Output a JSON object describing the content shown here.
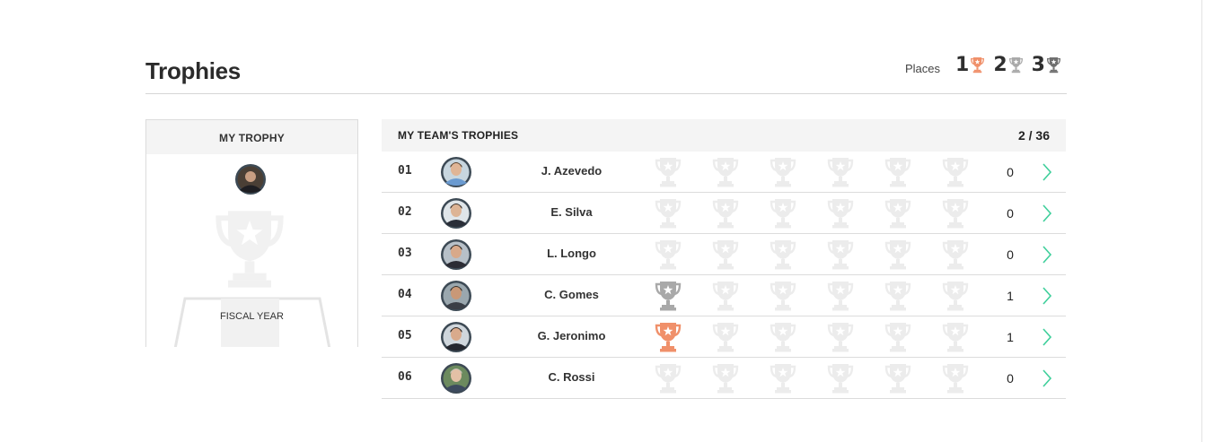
{
  "page": {
    "title": "Trophies"
  },
  "places": {
    "label": "Places",
    "items": [
      {
        "number": "1",
        "color": "#f0906a",
        "icon": "trophy-icon"
      },
      {
        "number": "2",
        "color": "#a9a9a9",
        "icon": "trophy-icon"
      },
      {
        "number": "3",
        "color": "#6f6f6f",
        "icon": "trophy-icon"
      }
    ]
  },
  "my_trophy": {
    "title": "MY TROPHY",
    "period_label": "FISCAL YEAR"
  },
  "team": {
    "title": "MY TEAM'S TROPHIES",
    "count": "2 / 36",
    "rows": [
      {
        "rank": "01",
        "name": "J. Azevedo",
        "score": "0",
        "trophies": [
          null,
          null,
          null,
          null,
          null,
          null
        ]
      },
      {
        "rank": "02",
        "name": "E. Silva",
        "score": "0",
        "trophies": [
          null,
          null,
          null,
          null,
          null,
          null
        ]
      },
      {
        "rank": "03",
        "name": "L. Longo",
        "score": "0",
        "trophies": [
          null,
          null,
          null,
          null,
          null,
          null
        ]
      },
      {
        "rank": "04",
        "name": "C. Gomes",
        "score": "1",
        "trophies": [
          "silver",
          null,
          null,
          null,
          null,
          null
        ]
      },
      {
        "rank": "05",
        "name": "G. Jeronimo",
        "score": "1",
        "trophies": [
          "gold",
          null,
          null,
          null,
          null,
          null
        ]
      },
      {
        "rank": "06",
        "name": "C. Rossi",
        "score": "0",
        "trophies": [
          null,
          null,
          null,
          null,
          null,
          null
        ]
      }
    ]
  },
  "colors": {
    "gold": "#f0906a",
    "silver": "#a9a9a9",
    "bronze": "#6f6f6f",
    "empty": "#ececec",
    "accent_green": "#3fcf9b",
    "avatar_ring": "#3d4a55"
  }
}
